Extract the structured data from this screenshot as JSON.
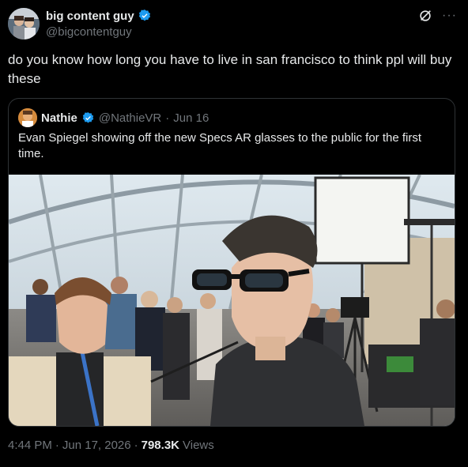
{
  "author": {
    "display_name": "big content guy",
    "handle": "@bigcontentguy",
    "verified_color": "#1d9bf0"
  },
  "top_icons": [
    "grok-icon",
    "more-options-icon"
  ],
  "more_label": "···",
  "tweet": {
    "text": "do you know how long you have to live in san francisco to think ppl will buy these"
  },
  "quoted": {
    "display_name": "Nathie",
    "handle": "@NathieVR",
    "date": "Jun 16",
    "separator": "·",
    "text": "Evan Spiegel showing off the new Specs AR glasses to the public for the first time."
  },
  "footer": {
    "time": "4:44 PM",
    "date": "Jun 17, 2026",
    "views_count": "798.3K",
    "views_label": "Views",
    "sep": "·"
  }
}
